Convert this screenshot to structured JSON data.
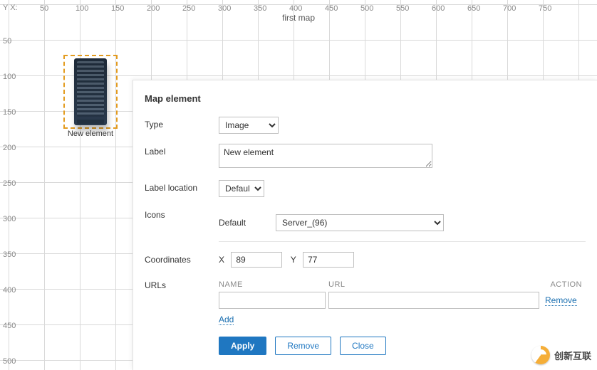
{
  "canvas": {
    "yx_label": "Y X:",
    "title": "first map",
    "x_ticks": [
      "50",
      "100",
      "150",
      "200",
      "250",
      "300",
      "350",
      "400",
      "450",
      "500",
      "550",
      "600",
      "650",
      "700",
      "750"
    ],
    "y_ticks": [
      "50",
      "100",
      "150",
      "200",
      "250",
      "300",
      "350",
      "400",
      "450",
      "500"
    ],
    "selected_element_label": "New element"
  },
  "dialog": {
    "title": "Map element",
    "fields": {
      "type_label": "Type",
      "type_value": "Image",
      "label_label": "Label",
      "label_value": "New element",
      "location_label": "Label location",
      "location_value": "Default",
      "icons_label": "Icons",
      "icons_default_label": "Default",
      "icons_value": "Server_(96)",
      "coords_label": "Coordinates",
      "coord_x_label": "X",
      "coord_x_value": "89",
      "coord_y_label": "Y",
      "coord_y_value": "77",
      "urls_label": "URLs",
      "urls_head_name": "NAME",
      "urls_head_url": "URL",
      "urls_head_action": "ACTION",
      "urls_remove": "Remove",
      "urls_add": "Add"
    },
    "buttons": {
      "apply": "Apply",
      "remove": "Remove",
      "close": "Close"
    }
  },
  "watermark": {
    "text": "创新互联"
  }
}
